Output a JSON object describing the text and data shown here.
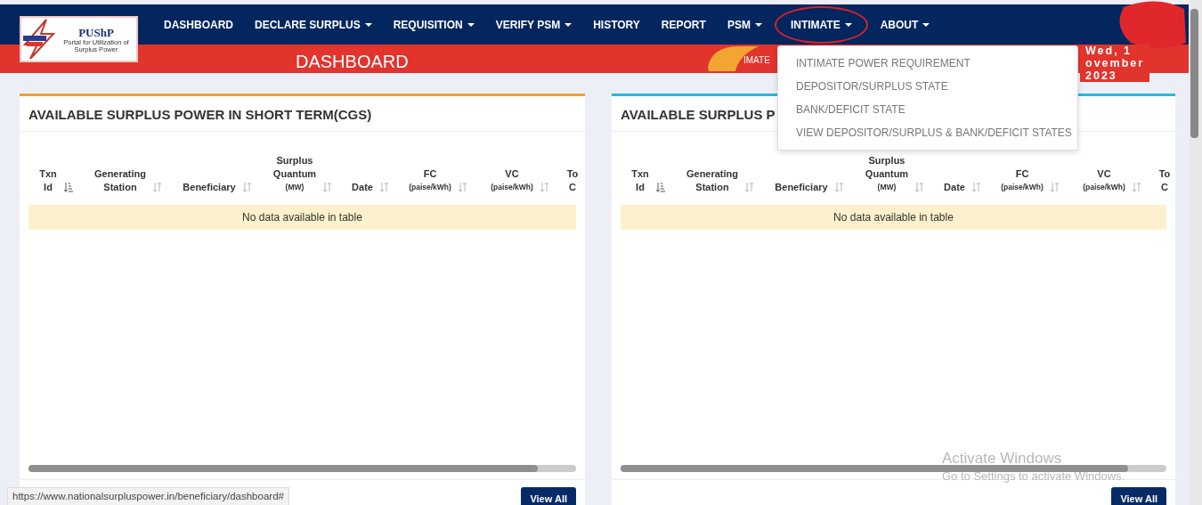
{
  "logo": {
    "title": "PUShP",
    "subtitle": "Portal for Utilization of Surplus Power"
  },
  "nav": [
    {
      "label": "DASHBOARD",
      "dropdown": false,
      "expanded": false
    },
    {
      "label": "DECLARE SURPLUS",
      "dropdown": true,
      "expanded": false
    },
    {
      "label": "REQUISITION",
      "dropdown": true,
      "expanded": false
    },
    {
      "label": "VERIFY PSM",
      "dropdown": true,
      "expanded": false
    },
    {
      "label": "HISTORY",
      "dropdown": false,
      "expanded": false
    },
    {
      "label": "REPORT",
      "dropdown": false,
      "expanded": false
    },
    {
      "label": "PSM",
      "dropdown": true,
      "expanded": false
    },
    {
      "label": "INTIMATE",
      "dropdown": true,
      "expanded": true
    },
    {
      "label": "ABOUT",
      "dropdown": true,
      "expanded": false
    }
  ],
  "dropdown_menu": [
    "INTIMATE POWER REQUIREMENT",
    "DEPOSITOR/SURPLUS STATE",
    "BANK/DEFICIT STATE",
    "VIEW DEPOSITOR/SURPLUS & BANK/DEFICIT STATES"
  ],
  "page_title": "DASHBOARD",
  "ticker": "IMATE",
  "date_lines": [
    "Wed, 1",
    "ovember",
    "2023"
  ],
  "panels": [
    {
      "title": "AVAILABLE SURPLUS POWER IN SHORT TERM(CGS)",
      "color": "#f0a030",
      "empty_message": "No data available in table",
      "button": "View All",
      "columns": [
        {
          "lines": [
            "Txn",
            "Id"
          ],
          "sorted": true
        },
        {
          "lines": [
            "Generating",
            "Station"
          ],
          "sorted": false
        },
        {
          "lines": [
            "Beneficiary"
          ],
          "sorted": false
        },
        {
          "lines": [
            "Surplus",
            "Quantum"
          ],
          "unit": "(MW)",
          "sorted": false
        },
        {
          "lines": [
            "Date"
          ],
          "sorted": false
        },
        {
          "lines": [
            "FC"
          ],
          "unit": "(paise/kWh)",
          "sorted": false
        },
        {
          "lines": [
            "VC"
          ],
          "unit": "(paise/kWh)",
          "sorted": false
        },
        {
          "lines": [
            "To",
            "C"
          ]
        }
      ]
    },
    {
      "title": "AVAILABLE SURPLUS P",
      "color": "#22b8e8",
      "empty_message": "No data available in table",
      "button": "View All",
      "columns": [
        {
          "lines": [
            "Txn",
            "Id"
          ],
          "sorted": true
        },
        {
          "lines": [
            "Generating",
            "Station"
          ],
          "sorted": false
        },
        {
          "lines": [
            "Beneficiary"
          ],
          "sorted": false
        },
        {
          "lines": [
            "Surplus",
            "Quantum"
          ],
          "unit": "(MW)",
          "sorted": false
        },
        {
          "lines": [
            "Date"
          ],
          "sorted": false
        },
        {
          "lines": [
            "FC"
          ],
          "unit": "(paise/kWh)",
          "sorted": false
        },
        {
          "lines": [
            "VC"
          ],
          "unit": "(paise/kWh)",
          "sorted": false
        },
        {
          "lines": [
            "To",
            "C"
          ]
        }
      ]
    }
  ],
  "status_url": "https://www.nationalsurpluspower.in/beneficiary/dashboard#",
  "os_notice": {
    "title": "Activate Windows",
    "text": "Go to Settings to activate Windows."
  }
}
